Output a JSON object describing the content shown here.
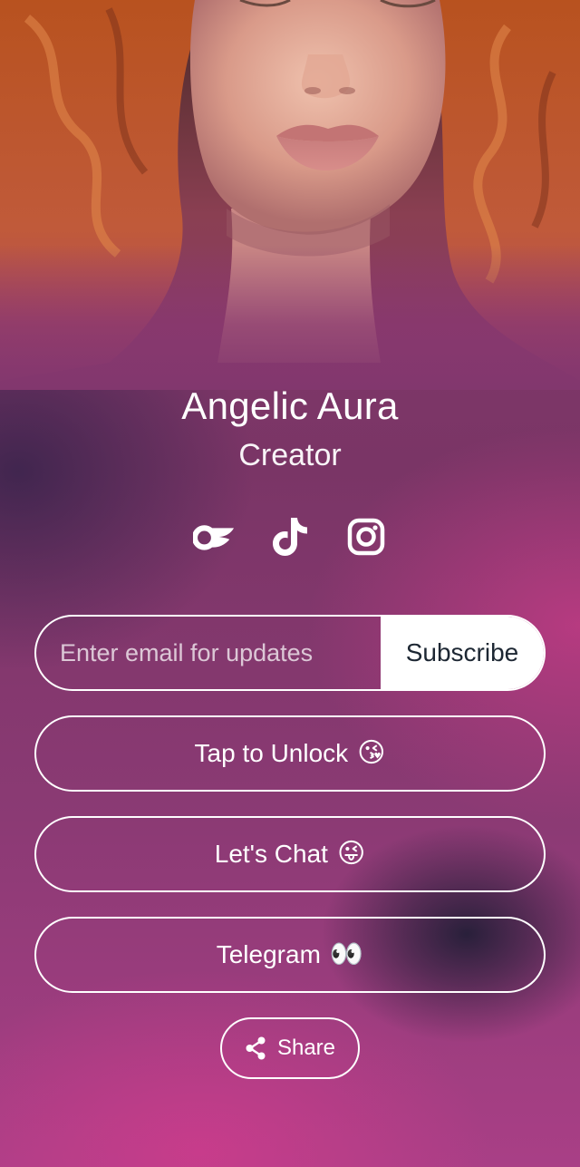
{
  "profile": {
    "name": "Angelic Aura",
    "role": "Creator"
  },
  "socials": [
    {
      "icon": "onlyfans-icon"
    },
    {
      "icon": "tiktok-icon"
    },
    {
      "icon": "instagram-icon"
    }
  ],
  "subscribe": {
    "placeholder": "Enter email for updates",
    "button_label": "Subscribe"
  },
  "links": [
    {
      "label": "Tap to Unlock",
      "emoji": "😘"
    },
    {
      "label": "Let's Chat",
      "emoji": "😜"
    },
    {
      "label": "Telegram",
      "emoji": "👀"
    }
  ],
  "share": {
    "label": "Share",
    "icon": "share-icon"
  },
  "colors": {
    "background_primary": "#8a3a6e",
    "background_accent": "#c23f8a",
    "text": "#ffffff",
    "subscribe_text": "#1d2733"
  }
}
